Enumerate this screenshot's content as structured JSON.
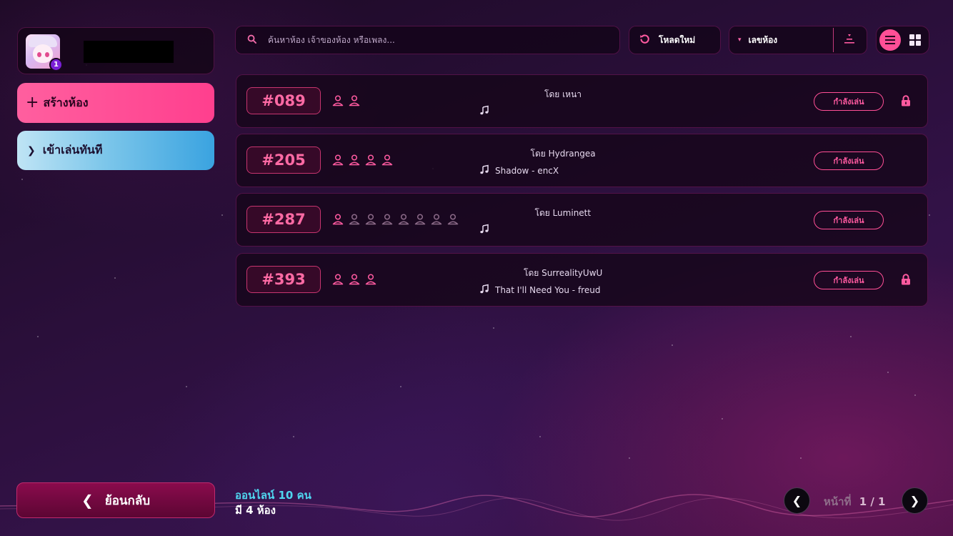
{
  "profile": {
    "level": "1"
  },
  "sidebar": {
    "create_room": "สร้างห้อง",
    "quick_play": "เข้าเล่นทันที",
    "back": "ย้อนกลับ"
  },
  "search": {
    "placeholder": "ค้นหาห้อง เจ้าของห้อง หรือเพลง..."
  },
  "toolbar": {
    "reload": "โหลดใหม่",
    "sort_label": "เลขห้อง"
  },
  "status_label": "กำลังเล่น",
  "rooms": [
    {
      "id": "#089",
      "host": "โดย เหนา",
      "song": "",
      "players": 2,
      "capacity": 2,
      "locked": true
    },
    {
      "id": "#205",
      "host": "โดย Hydrangea",
      "song": "Shadow - encX",
      "players": 4,
      "capacity": 4,
      "locked": false
    },
    {
      "id": "#287",
      "host": "โดย Luminett",
      "song": "",
      "players": 1,
      "capacity": 8,
      "locked": false
    },
    {
      "id": "#393",
      "host": "โดย SurrealityUwU",
      "song": "That I'll Need You - freud",
      "players": 3,
      "capacity": 3,
      "locked": true
    }
  ],
  "footer": {
    "online": "ออนไลน์ 10 คน",
    "room_count": "มี 4 ห้อง"
  },
  "pagination": {
    "label": "หน้าที่",
    "current": "1 / 1"
  },
  "colors": {
    "accent": "#ff4f96",
    "accent_cyan": "#4fd6ef",
    "panel": "#16061a"
  }
}
